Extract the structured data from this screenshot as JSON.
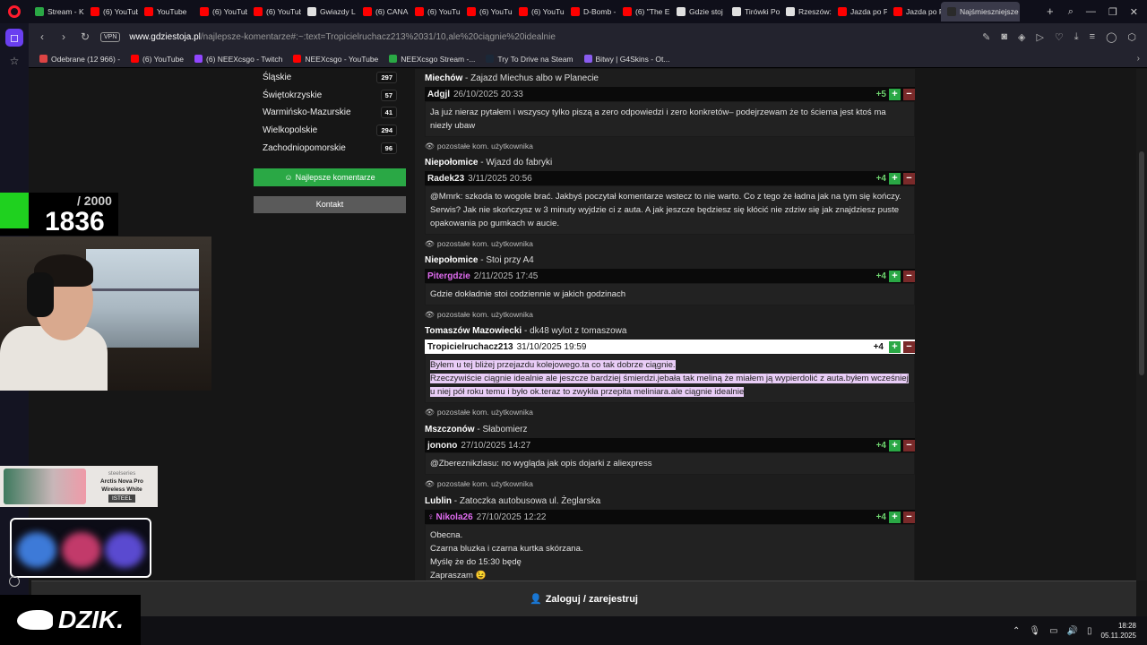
{
  "browser": {
    "tabs": [
      {
        "label": "Stream - K",
        "color": "#2aa845"
      },
      {
        "label": "(6) YouTub",
        "color": "#ff0000"
      },
      {
        "label": "YouTube",
        "color": "#ff0000"
      },
      {
        "label": "(6) YouTub",
        "color": "#ff0000"
      },
      {
        "label": "(6) YouTub",
        "color": "#ff0000"
      },
      {
        "label": "Gwiazdy L",
        "color": "#e0e0e0"
      },
      {
        "label": "(6) CANAL",
        "color": "#ff0000"
      },
      {
        "label": "(6) YouTub",
        "color": "#ff0000"
      },
      {
        "label": "(6) YouTub",
        "color": "#ff0000"
      },
      {
        "label": "(6) YouTub",
        "color": "#ff0000"
      },
      {
        "label": "D-Bomb -",
        "color": "#ff0000"
      },
      {
        "label": "(6) \"The E",
        "color": "#ff0000"
      },
      {
        "label": "Gdzie stoj",
        "color": "#e0e0e0"
      },
      {
        "label": "Tirówki Po",
        "color": "#e0e0e0"
      },
      {
        "label": "Rzeszów:",
        "color": "#e0e0e0"
      },
      {
        "label": "Jazda po P",
        "color": "#ff0000"
      },
      {
        "label": "Jazda po P",
        "color": "#ff0000"
      },
      {
        "label": "Najśmieszniejsze",
        "color": "#2a2a2a",
        "active": true
      }
    ],
    "vpn_label": "VPN",
    "url_host": "www.gdziestoja.pl",
    "url_path": "/najlepsze-komentarze#:~:text=Tropicielruchacz213%2031/10,ale%20ciągnie%20idealnie",
    "bookmarks": [
      {
        "label": "Odebrane (12 966) -",
        "color": "#d44"
      },
      {
        "label": "(6) YouTube",
        "color": "#ff0000"
      },
      {
        "label": "(6) NEEXcsgo - Twitch",
        "color": "#9146ff"
      },
      {
        "label": "NEEXcsgo - YouTube",
        "color": "#ff0000"
      },
      {
        "label": "NEEXcsgo Stream -...",
        "color": "#2aa845"
      },
      {
        "label": "Try To Drive na Steam",
        "color": "#1b2838"
      },
      {
        "label": "Bitwy | G4Skins - Ot...",
        "color": "#8a5cf0"
      }
    ]
  },
  "regions": [
    {
      "name": "Śląskie",
      "count": "297"
    },
    {
      "name": "Świętokrzyskie",
      "count": "57"
    },
    {
      "name": "Warmińsko-Mazurskie",
      "count": "41"
    },
    {
      "name": "Wielkopolskie",
      "count": "294"
    },
    {
      "name": "Zachodniopomorskie",
      "count": "96"
    }
  ],
  "buttons": {
    "best_comments": "Najlepsze komentarze",
    "contact": "Kontakt",
    "login": "Zaloguj / zarejestruj"
  },
  "comments": [
    {
      "city": "Miechów",
      "place": "Zajazd Miechus albo w Planecie",
      "user": "Adgjl",
      "date": "26/10/2025 20:33",
      "score": "+5",
      "body": [
        "Ja już nieraz pytałem i wszyscy tylko piszą a zero odpowiedzi i zero konkretów– podejrzewam że to ściema jest ktoś ma niezły ubaw"
      ],
      "more": "pozostałe kom. użytkownika"
    },
    {
      "city": "Niepołomice",
      "place": "Wjazd do fabryki",
      "user": "Radek23",
      "date": "3/11/2025 20:56",
      "score": "+4",
      "body": [
        "@Mmrk: szkoda to wogole brać. Jakbyś poczytał komentarze wstecz to nie warto. Co z tego że ładna jak na tym się kończy. Serwis? Jak nie skończysz w 3 minuty wyjdzie ci z auta. A jak jeszcze będziesz się kłócić nie zdziw się jak znajdziesz puste opakowania po gumkach w aucie."
      ],
      "more": "pozostałe kom. użytkownika"
    },
    {
      "city": "Niepołomice",
      "place": "Stoi przy A4",
      "user": "Pitergdzie",
      "date": "2/11/2025 17:45",
      "score": "+4",
      "body": [
        "Gdzie dokładnie stoi codziennie w jakich godzinach"
      ],
      "more": "pozostałe kom. użytkownika"
    },
    {
      "city": "Tomaszów Mazowiecki",
      "place": "dk48 wylot z tomaszowa",
      "user": "Tropicielruchacz213",
      "date": "31/10/2025 19:59",
      "score": "+4",
      "body": [
        "Byłem u tej bliżej przejazdu kolejowego.ta co tak dobrze ciągnie.",
        "Rzeczywiście ciągnie idealnie ale jeszcze bardziej śmierdzi.jebała tak meliną że miałem ją wypierdolić z auta.byłem wcześniej u niej pół roku temu i było ok.teraz to zwykła przepita meliniara.ale ciągnie idealnie"
      ],
      "more": "pozostałe kom. użytkownika"
    },
    {
      "city": "Mszczonów",
      "place": "Słabomierz",
      "user": "jonono",
      "date": "27/10/2025 14:27",
      "score": "+4",
      "body": [
        "@Zbereznikzlasu: no wygląda jak opis dojarki z aliexpress"
      ],
      "more": "pozostałe kom. użytkownika"
    },
    {
      "city": "Lublin",
      "place": "Zatoczka autobusowa ul. Żeglarska",
      "user": "Nikola26",
      "date": "27/10/2025 12:22",
      "score": "+4",
      "body": [
        "Obecna.",
        "Czarna bluzka i czarna kurtka skórzana.",
        "Myślę że do 15:30 będę",
        "Zapraszam 😉"
      ],
      "more": ""
    }
  ],
  "stream": {
    "counter_total": "/ 2000",
    "counter_value": "1836",
    "ad_brand": "steelseries",
    "ad_product": "Arctis Nova Pro Wireless White",
    "ad_tag": "ISTEEL",
    "logo_text": "DZIK."
  },
  "taskbar": {
    "time": "18:28",
    "date": "05.11.2025"
  }
}
